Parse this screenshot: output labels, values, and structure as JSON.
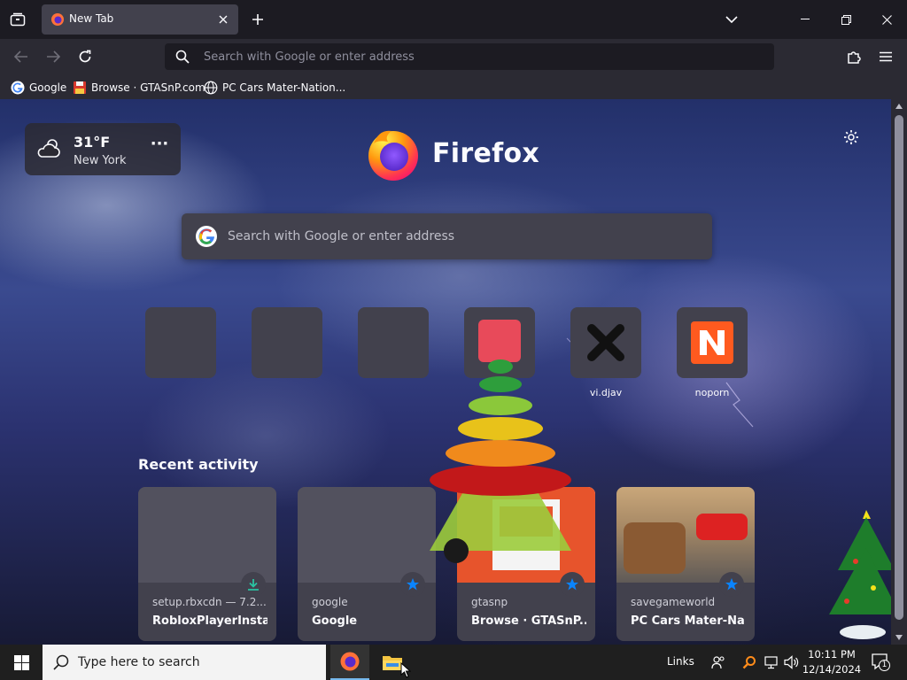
{
  "tabstrip": {
    "active_tab_title": "New Tab"
  },
  "navbar": {
    "url_placeholder": "Search with Google or enter address"
  },
  "bookmarks": [
    {
      "label": "Google",
      "icon": "google-g-icon"
    },
    {
      "label": "Browse · GTASnP.com",
      "icon": "floppy-disk-icon"
    },
    {
      "label": "PC Cars Mater-Nation...",
      "icon": "globe-icon"
    }
  ],
  "weather": {
    "temperature": "31°F",
    "city": "New York",
    "icon": "cloud-sun-icon"
  },
  "brand": {
    "wordmark": "Firefox"
  },
  "search": {
    "placeholder": "Search with Google or enter address"
  },
  "shortcuts": [
    {
      "label": "",
      "icon": ""
    },
    {
      "label": "",
      "icon": ""
    },
    {
      "label": "",
      "icon": ""
    },
    {
      "label": "",
      "icon": "red-site-icon"
    },
    {
      "label": "vi.djav",
      "icon": "x-logo-icon"
    },
    {
      "label": "noporn",
      "icon": "n-logo-icon"
    }
  ],
  "recent": {
    "title": "Recent activity",
    "cards": [
      {
        "source": "setup.rbxcdn — 7.2...",
        "title": "RobloxPlayerInsta...",
        "badge": "download-icon"
      },
      {
        "source": "google",
        "title": "Google",
        "badge": "bookmark-star-icon"
      },
      {
        "source": "gtasnp",
        "title": "Browse · GTASnP....",
        "badge": "bookmark-star-icon"
      },
      {
        "source": "savegameworld",
        "title": "PC Cars Mater-Na...",
        "badge": "bookmark-star-icon"
      }
    ]
  },
  "taskbar": {
    "search_placeholder": "Type here to search",
    "links_label": "Links",
    "time": "10:11 PM",
    "date": "12/14/2024",
    "notification_count": "1"
  },
  "colors": {
    "accent_blue": "#0a84ff",
    "download_green": "#2ac3a2"
  }
}
